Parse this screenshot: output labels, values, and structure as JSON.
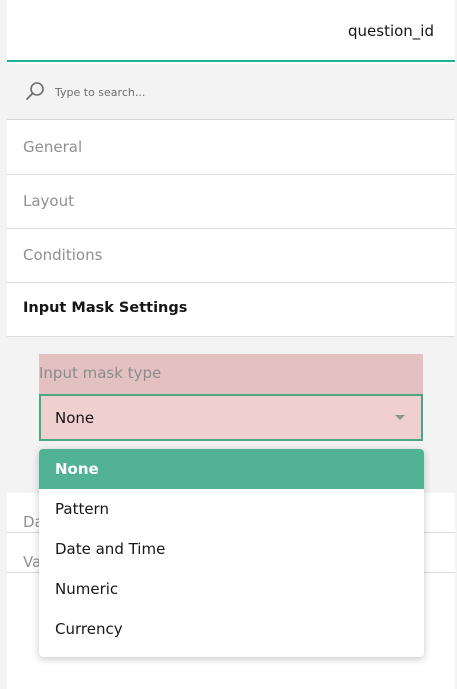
{
  "header": {
    "title": "question_id"
  },
  "search": {
    "placeholder": "Type to search..."
  },
  "sections": [
    {
      "label": "General"
    },
    {
      "label": "Layout"
    },
    {
      "label": "Conditions"
    },
    {
      "label": "Input Mask Settings"
    }
  ],
  "input_mask": {
    "label": "Input mask type",
    "selected_value": "None"
  },
  "hidden_rows": [
    {
      "label": "Da"
    },
    {
      "label": "Va"
    }
  ],
  "dropdown": {
    "options": [
      "None",
      "Pattern",
      "Date and Time",
      "Numeric",
      "Currency"
    ],
    "selected_index": 0
  },
  "colors": {
    "accent": "#19b394",
    "selected_option_bg": "#52b294",
    "highlight_bg": "#e3c1c1",
    "select_border": "#4aa883"
  }
}
